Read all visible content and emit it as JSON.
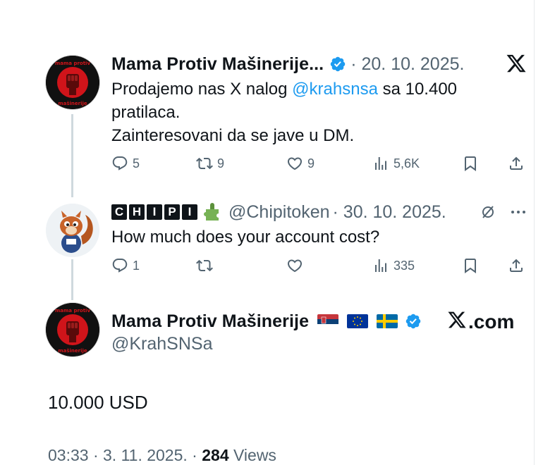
{
  "tweet1": {
    "author": "Mama Protiv Mašinerije...",
    "date": "· 20. 10. 2025.",
    "source_logo": "X",
    "line1_pre": "Prodajemo nas X nalog ",
    "mention": "@krahsnsa",
    "line1_post": " sa 10.400",
    "line2": "pratilaca.",
    "line3": "Zainteresovani da se jave  u DM.",
    "replies": "5",
    "reposts": "9",
    "likes": "9",
    "views": "5,6K"
  },
  "tweet2": {
    "author": "CHIPI",
    "author_letters": [
      "C",
      "H",
      "I",
      "P",
      "I"
    ],
    "emoji": "puzzle-piece",
    "handle": "@Chipitoken",
    "date": "· 30. 10. 2025.",
    "text": "How much does your account cost?",
    "replies": "1",
    "reposts": "",
    "likes": "",
    "views": "335"
  },
  "tweet3": {
    "author": "Mama Protiv Mašinerije",
    "flags": [
      "serbia-flag",
      "eu-flag",
      "sweden-flag"
    ],
    "handle": "@KrahSNSa",
    "source": "X.com",
    "text": "10.000 USD",
    "time": "03:33 · 3. 11. 2025. · ",
    "views_count": "284",
    "views_label": " Views"
  },
  "avatar_text": {
    "top": "mama protiv",
    "bottom": "mašinerije"
  },
  "colors": {
    "accent": "#1d9bf0",
    "muted": "#536471",
    "text": "#0f1419",
    "logo_red": "#d0141a"
  }
}
